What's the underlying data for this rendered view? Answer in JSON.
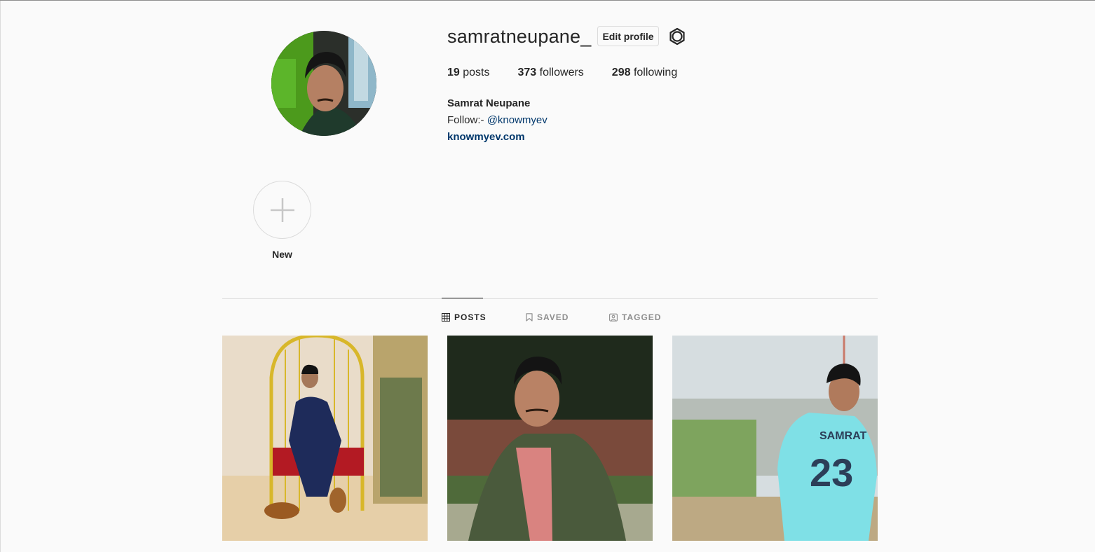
{
  "profile": {
    "username": "samratneupane_",
    "edit_label": "Edit profile",
    "full_name": "Samrat Neupane",
    "bio_prefix": "Follow:- ",
    "bio_mention": "@knowmyev",
    "website": "knowmyev.com"
  },
  "stats": {
    "posts_count": "19",
    "posts_label": "posts",
    "followers_count": "373",
    "followers_label": "followers",
    "following_count": "298",
    "following_label": "following"
  },
  "highlights": {
    "new_label": "New"
  },
  "tabs": {
    "posts": "POSTS",
    "saved": "SAVED",
    "tagged": "TAGGED"
  },
  "colors": {
    "link": "#00376b",
    "border": "#dbdbdb",
    "muted": "#8e8e8e",
    "background": "#fafafa"
  },
  "icons": {
    "settings": "gear-icon",
    "add_highlight": "plus-icon",
    "posts_tab": "grid-icon",
    "saved_tab": "bookmark-icon",
    "tagged_tab": "tag-person-icon"
  }
}
